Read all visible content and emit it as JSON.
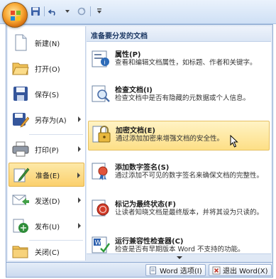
{
  "app": {
    "office_button_icon": "office-logo-icon",
    "quick_access": [
      {
        "name": "save-icon"
      },
      {
        "name": "undo-icon"
      },
      {
        "name": "redo-icon"
      },
      {
        "name": "customize-qat-icon"
      }
    ]
  },
  "left_menu": {
    "items": [
      {
        "id": "new",
        "label": "新建(N)",
        "icon": "new-document-icon",
        "has_submenu": false
      },
      {
        "id": "open",
        "label": "打开(O)",
        "icon": "open-folder-icon",
        "has_submenu": false
      },
      {
        "id": "save",
        "label": "保存(S)",
        "icon": "save-icon",
        "has_submenu": false
      },
      {
        "id": "save-as",
        "label": "另存为(A)",
        "icon": "save-as-icon",
        "has_submenu": true
      },
      {
        "id": "print",
        "label": "打印(P)",
        "icon": "printer-icon",
        "has_submenu": true
      },
      {
        "id": "prepare",
        "label": "准备(E)",
        "icon": "prepare-pen-icon",
        "has_submenu": true,
        "selected": true
      },
      {
        "id": "send",
        "label": "发送(D)",
        "icon": "send-icon",
        "has_submenu": true
      },
      {
        "id": "publish",
        "label": "发布(U)",
        "icon": "publish-icon",
        "has_submenu": true
      },
      {
        "id": "close",
        "label": "关闭(C)",
        "icon": "close-folder-icon",
        "has_submenu": false
      }
    ]
  },
  "right_panel": {
    "header": "准备要分发的文档",
    "items": [
      {
        "id": "properties",
        "title": "属性(P)",
        "desc": "查看和编辑文档属性，如标题、作者和关键字。",
        "icon": "properties-icon"
      },
      {
        "id": "inspect",
        "title": "检查文档(I)",
        "desc": "检查文档中是否有隐藏的元数据或个人信息。",
        "icon": "inspect-document-icon"
      },
      {
        "id": "encrypt",
        "title": "加密文档(E)",
        "desc": "通过添加加密来增强文档的安全性。",
        "icon": "encrypt-lock-icon",
        "hover": true
      },
      {
        "id": "signature",
        "title": "添加数字签名(S)",
        "desc": "通过添加不可见的数字签名来确保文档的完整性。",
        "icon": "digital-signature-icon"
      },
      {
        "id": "mark-final",
        "title": "标记为最终状态(F)",
        "desc": "让读者知晓文档是最终版本，并将其设为只读的。",
        "icon": "mark-final-icon"
      },
      {
        "id": "compat",
        "title": "运行兼容性检查器(C)",
        "desc": "检查是否有早期版本 Word 不支持的功能。",
        "icon": "compatibility-check-icon"
      }
    ]
  },
  "bottom": {
    "options_label": "Word 选项(I)",
    "exit_label": "退出 Word(X)"
  },
  "colors": {
    "accent_selected": "#fbd06d",
    "hover": "#fddf86",
    "frame": "#8ea9d1"
  }
}
